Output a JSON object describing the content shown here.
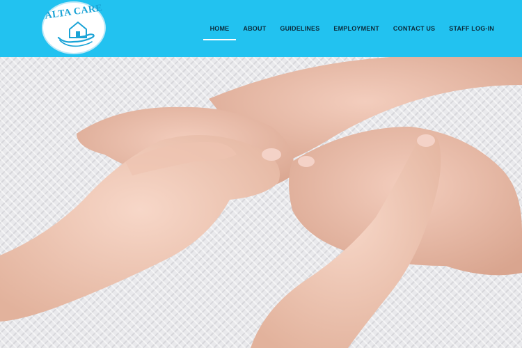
{
  "brand": {
    "name": "ALTA CARE",
    "logo_icon": "house-in-hand-icon"
  },
  "nav": {
    "items": [
      {
        "label": "HOME",
        "active": true
      },
      {
        "label": "ABOUT",
        "active": false
      },
      {
        "label": "GUIDELINES",
        "active": false
      },
      {
        "label": "EMPLOYMENT",
        "active": false
      },
      {
        "label": "CONTACT US",
        "active": false
      },
      {
        "label": "STAFF LOG-IN",
        "active": false
      }
    ]
  },
  "colors": {
    "header": "#22c2f0",
    "nav_text": "#0b2a3a",
    "active_underline": "#ffffff",
    "logo_text": "#1aa3d6"
  },
  "hero": {
    "image": "young-hands-holding-elderly-hands-photo"
  }
}
